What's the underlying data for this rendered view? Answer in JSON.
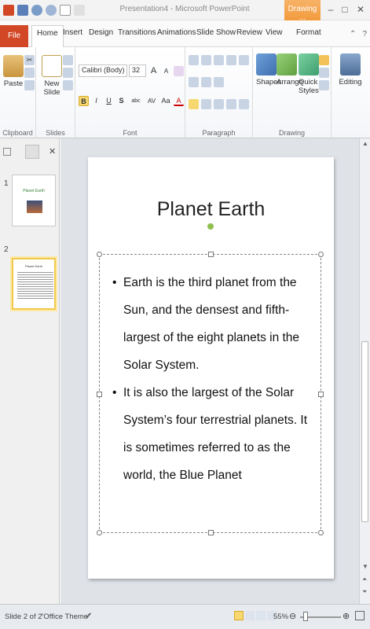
{
  "window": {
    "title": "Presentation4 - Microsoft PowerPoint",
    "context_tab": "Drawing ...",
    "minimize": "–",
    "maximize": "□",
    "close": "✕"
  },
  "tabs": {
    "file": "File",
    "items": [
      "Home",
      "Insert",
      "Design",
      "Transitions",
      "Animations",
      "Slide Show",
      "Review",
      "View",
      "Format"
    ]
  },
  "ribbon": {
    "clipboard": {
      "label": "Clipboard",
      "paste": "Paste"
    },
    "slides": {
      "label": "Slides",
      "new_slide": "New Slide"
    },
    "font": {
      "label": "Font",
      "font_name": "Calibri (Body)",
      "font_size": "32",
      "bold": "B",
      "italic": "I",
      "underline": "U",
      "strike": "S",
      "shadow": "abc",
      "spacing": "AV",
      "case": "Aa",
      "color": "A",
      "grow": "A",
      "shrink": "A"
    },
    "paragraph": {
      "label": "Paragraph"
    },
    "drawing": {
      "label": "Drawing",
      "shapes": "Shapes",
      "arrange": "Arrange",
      "quick_styles": "Quick Styles"
    },
    "editing": {
      "label": "Editing"
    }
  },
  "slides_panel": {
    "slide1": {
      "number": "1",
      "title": "Planet Earth"
    },
    "slide2": {
      "number": "2",
      "title": "Planet Earth"
    }
  },
  "slide": {
    "title": "Planet Earth",
    "bullets": [
      "Earth is the third planet  from the Sun, and the densest and fifth-largest  of the eight planets in the Solar  System.",
      "It is also the largest of the Solar System’s four terrestrial planets. It is sometimes referred to as the world, the Blue Planet"
    ]
  },
  "status": {
    "slide_info": "Slide 2 of 2",
    "theme": "\"Office Theme\"",
    "zoom": "55%"
  },
  "colors": {
    "file_tab": "#d24726",
    "context_tab": "#f29a3c",
    "selection": "#f2c94c"
  }
}
